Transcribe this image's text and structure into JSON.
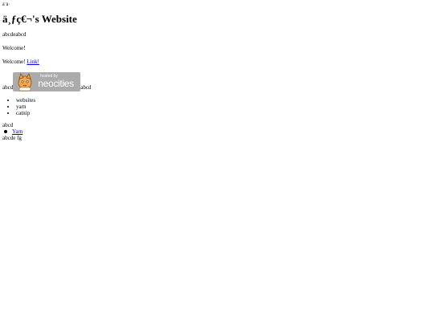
{
  "header": {
    "small_title": "ä¨ä·",
    "heading": "ä¸ƒç€¬'s Website"
  },
  "content": {
    "p1": "abcdeabcd",
    "p2": "Welcome!",
    "p3_text": "Welcome! ",
    "p3_link": "Link!",
    "badge_left_text": "abcd",
    "badge_right_text": "abcd",
    "badge_hosted_text": "hosted by",
    "badge_brand_text": "neocities",
    "list_items": [
      "websites",
      "yarn",
      "catnip"
    ],
    "after_list_text": "abcd",
    "link_list_item": "Yarn",
    "footer_text": "abcde fg"
  },
  "colors": {
    "link": "#0000ee",
    "badge_bg": "#ababab",
    "text": "#000000"
  }
}
